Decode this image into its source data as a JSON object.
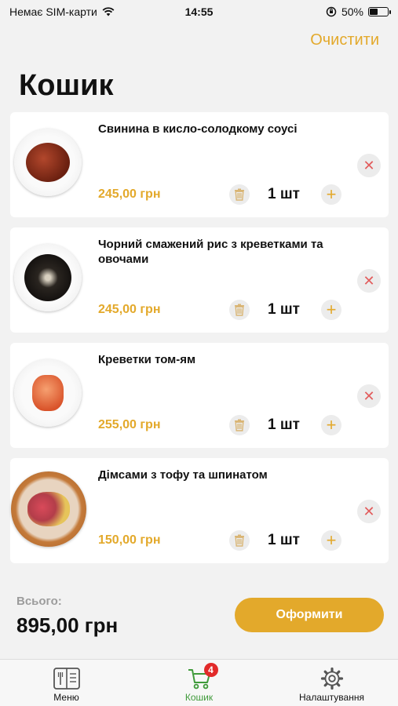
{
  "status_bar": {
    "carrier": "Немає SIM-карти",
    "time": "14:55",
    "battery": "50%",
    "battery_level": 0.5
  },
  "header": {
    "clear_label": "Очистити",
    "title": "Кошик"
  },
  "items": [
    {
      "name": "Свинина в кисло-солодкому соусі",
      "price": "245,00 грн",
      "qty": "1 шт"
    },
    {
      "name": "Чорний смажений рис з креветками та овочами",
      "price": "245,00 грн",
      "qty": "1 шт"
    },
    {
      "name": "Креветки том-ям",
      "price": "255,00 грн",
      "qty": "1 шт"
    },
    {
      "name": "Дімсами з тофу та шпинатом",
      "price": "150,00 грн",
      "qty": "1 шт"
    }
  ],
  "summary": {
    "total_label": "Всього:",
    "total_value": "895,00 грн",
    "checkout_label": "Оформити"
  },
  "tabs": [
    {
      "label": "Меню",
      "icon": "menu-book-icon"
    },
    {
      "label": "Кошик",
      "icon": "cart-icon",
      "badge": "4"
    },
    {
      "label": "Налаштування",
      "icon": "gear-icon"
    }
  ],
  "colors": {
    "accent": "#e3a92b",
    "active_tab": "#3f9a3a",
    "badge": "#e22a2a",
    "remove": "#e25c5c"
  }
}
